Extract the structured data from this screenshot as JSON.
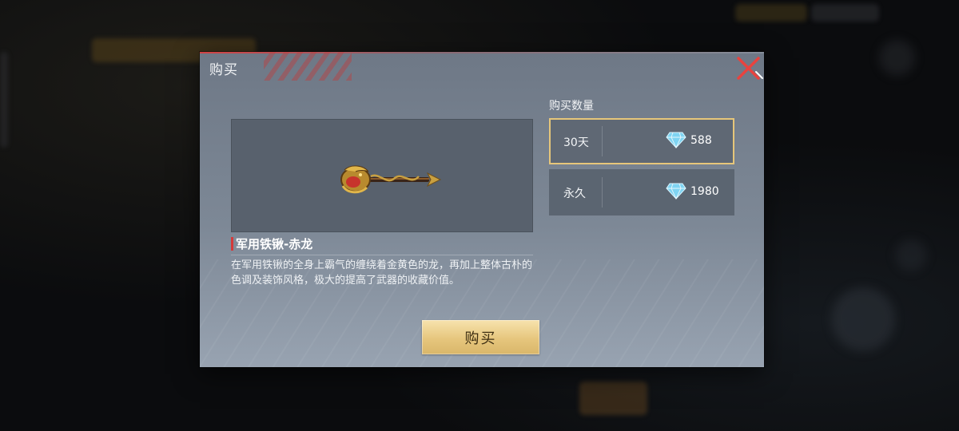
{
  "dialog": {
    "title": "购买",
    "close_icon": "close-x-icon"
  },
  "item": {
    "name": "军用铁锹-赤龙",
    "description": "在军用铁锹的全身上霸气的缠绕着金黄色的龙，再加上整体古朴的色调及装饰风格，极大的提高了武器的收藏价值。",
    "image_icon": "golden-dragon-shovel-image"
  },
  "purchase": {
    "quantity_label": "购买数量",
    "currency_icon": "diamond-icon",
    "options": [
      {
        "label": "30天",
        "price": "588",
        "selected": true
      },
      {
        "label": "永久",
        "price": "1980",
        "selected": false
      }
    ],
    "buy_label": "购买"
  },
  "colors": {
    "selected_border": "#e6c67a",
    "buy_button": "#e6c67d",
    "accent_red": "#d43a3a"
  }
}
